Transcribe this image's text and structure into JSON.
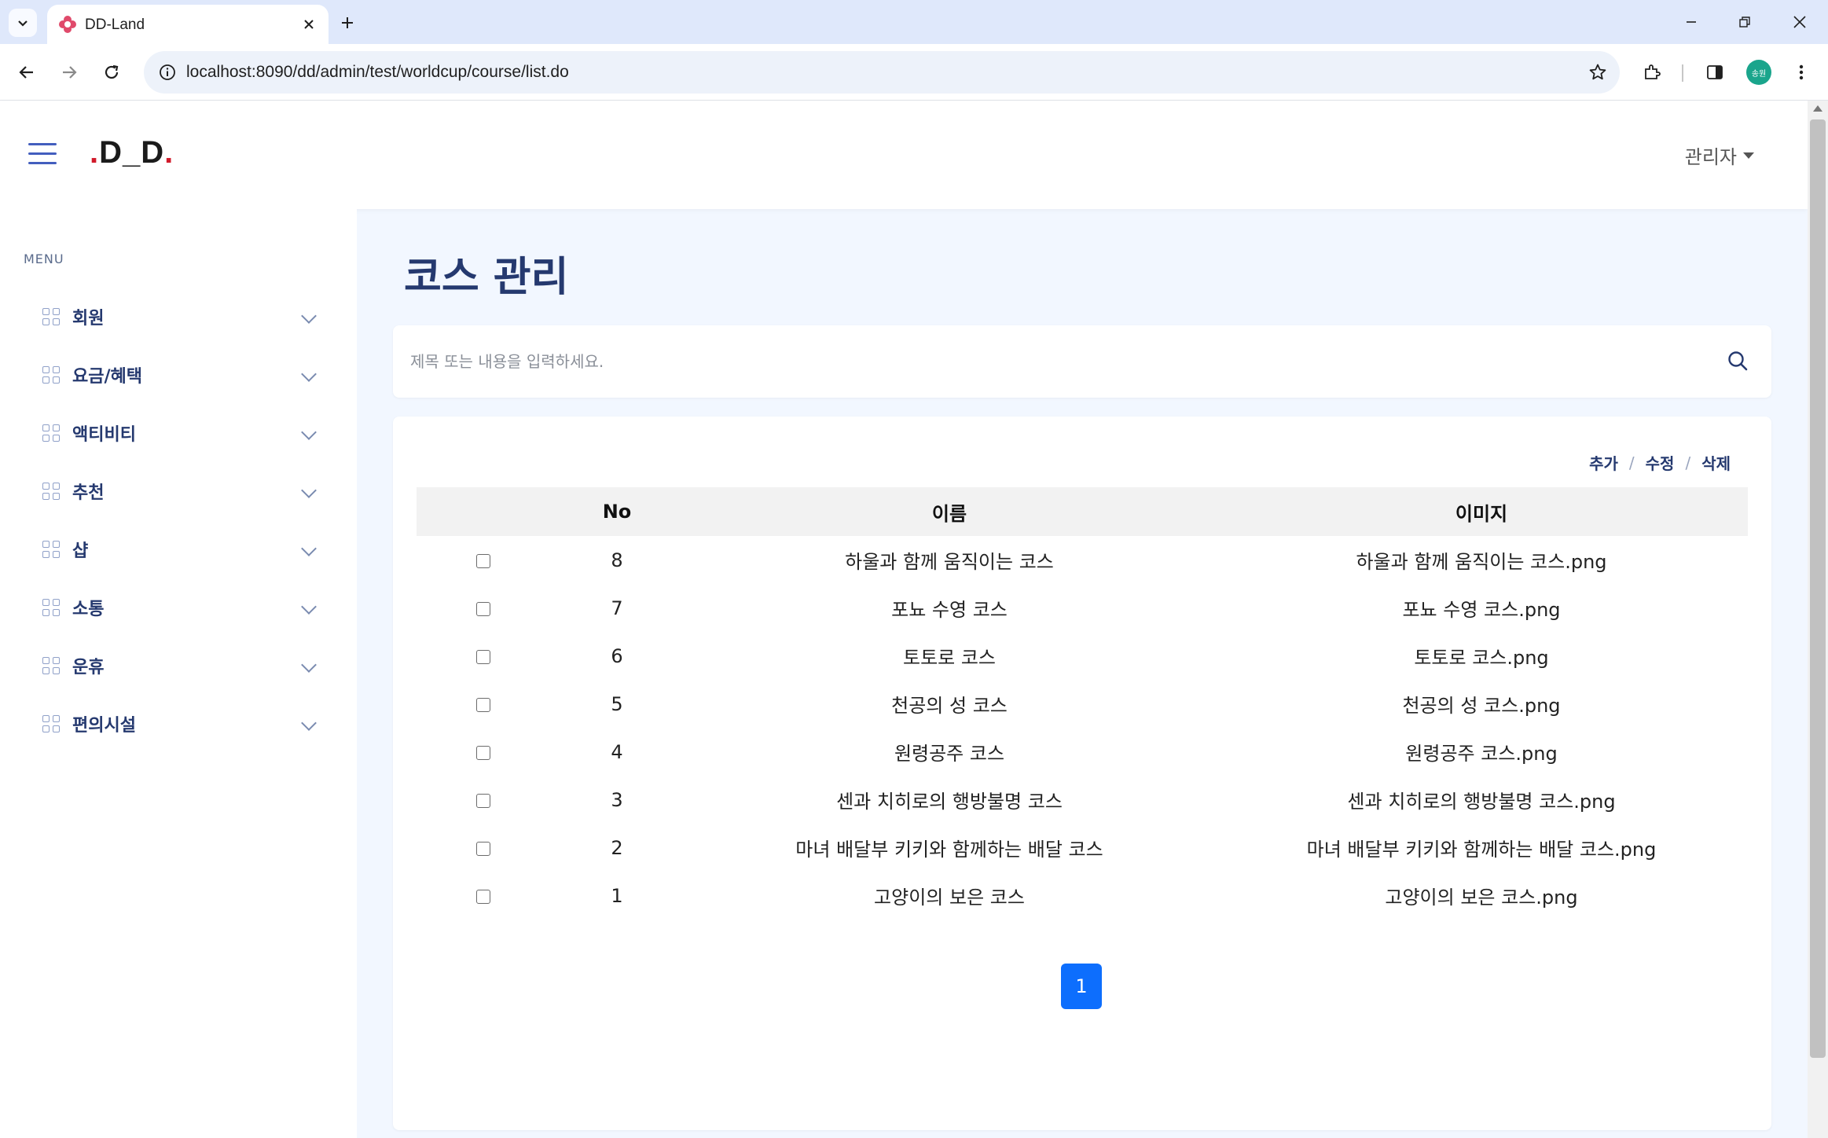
{
  "browser": {
    "tab_title": "DD-Land",
    "url": "localhost:8090/dd/admin/test/worldcup/course/list.do",
    "profile_label": "송원"
  },
  "header": {
    "brand": "D_D",
    "user_menu": "관리자"
  },
  "sidebar": {
    "menu_title": "MENU",
    "items": [
      {
        "label": "회원"
      },
      {
        "label": "요금/혜택"
      },
      {
        "label": "액티비티"
      },
      {
        "label": "추천"
      },
      {
        "label": "샵"
      },
      {
        "label": "소통"
      },
      {
        "label": "운휴"
      },
      {
        "label": "편의시설"
      }
    ]
  },
  "main": {
    "page_title": "코스 관리",
    "search": {
      "placeholder": "제목 또는 내용을 입력하세요."
    },
    "actions": {
      "add": "추가",
      "edit": "수정",
      "delete": "삭제",
      "separator": "/"
    },
    "table": {
      "headers": {
        "no": "No",
        "name": "이름",
        "image": "이미지"
      },
      "rows": [
        {
          "no": "8",
          "name": "하울과 함께 움직이는 코스",
          "image": "하울과 함께 움직이는 코스.png"
        },
        {
          "no": "7",
          "name": "포뇨 수영 코스",
          "image": "포뇨 수영 코스.png"
        },
        {
          "no": "6",
          "name": "토토로 코스",
          "image": "토토로 코스.png"
        },
        {
          "no": "5",
          "name": "천공의 성 코스",
          "image": "천공의 성 코스.png"
        },
        {
          "no": "4",
          "name": "원령공주 코스",
          "image": "원령공주 코스.png"
        },
        {
          "no": "3",
          "name": "센과 치히로의 행방불명 코스",
          "image": "센과 치히로의 행방불명 코스.png"
        },
        {
          "no": "2",
          "name": "마녀 배달부 키키와 함께하는 배달 코스",
          "image": "마녀 배달부 키키와 함께하는 배달 코스.png"
        },
        {
          "no": "1",
          "name": "고양이의 보은 코스",
          "image": "고양이의 보은 코스.png"
        }
      ]
    },
    "pagination": {
      "current": "1"
    }
  },
  "colors": {
    "accent": "#435ebe",
    "title": "#25396f",
    "pager": "#0d6efd",
    "brand_dot": "#d11a2a"
  }
}
